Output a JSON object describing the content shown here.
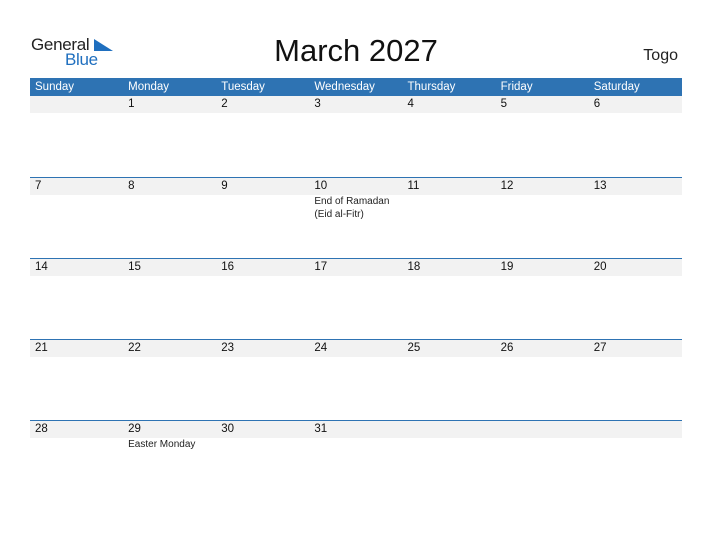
{
  "logo": {
    "word1": "General",
    "word2": "Blue",
    "accent": "#1f6fbf"
  },
  "title": "March 2027",
  "country": "Togo",
  "colors": {
    "header_bg": "#2e73b3",
    "daynum_bg": "#f2f2f2"
  },
  "weekdays": [
    "Sunday",
    "Monday",
    "Tuesday",
    "Wednesday",
    "Thursday",
    "Friday",
    "Saturday"
  ],
  "weeks": [
    {
      "days": [
        "",
        "1",
        "2",
        "3",
        "4",
        "5",
        "6"
      ],
      "events": [
        "",
        "",
        "",
        "",
        "",
        "",
        ""
      ]
    },
    {
      "days": [
        "7",
        "8",
        "9",
        "10",
        "11",
        "12",
        "13"
      ],
      "events": [
        "",
        "",
        "",
        "End of Ramadan (Eid al-Fitr)",
        "",
        "",
        ""
      ]
    },
    {
      "days": [
        "14",
        "15",
        "16",
        "17",
        "18",
        "19",
        "20"
      ],
      "events": [
        "",
        "",
        "",
        "",
        "",
        "",
        ""
      ]
    },
    {
      "days": [
        "21",
        "22",
        "23",
        "24",
        "25",
        "26",
        "27"
      ],
      "events": [
        "",
        "",
        "",
        "",
        "",
        "",
        ""
      ]
    },
    {
      "days": [
        "28",
        "29",
        "30",
        "31",
        "",
        "",
        ""
      ],
      "events": [
        "",
        "Easter Monday",
        "",
        "",
        "",
        "",
        ""
      ]
    }
  ]
}
